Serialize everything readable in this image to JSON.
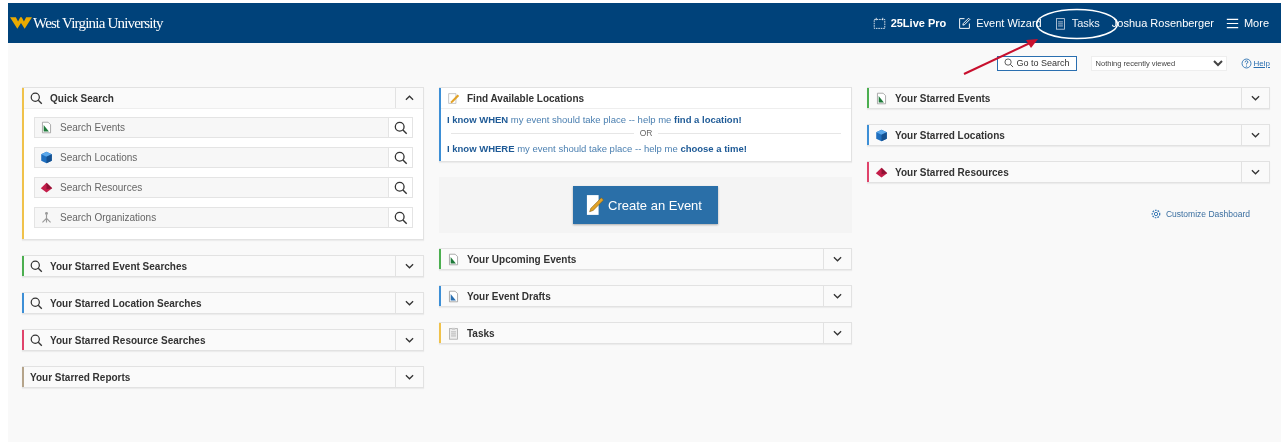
{
  "header": {
    "logo": "West Virginia University",
    "nav": [
      {
        "kind": "calendar",
        "label": "25Live Pro",
        "circled": false
      },
      {
        "kind": "edit",
        "label": "Event Wizard",
        "circled": false
      },
      {
        "kind": "clipboard",
        "label": "Tasks",
        "circled": true
      },
      {
        "kind": "user",
        "label": "Joshua Rosenberger",
        "circled": false
      },
      {
        "kind": "menu",
        "label": "More",
        "circled": false
      }
    ]
  },
  "toolbar": {
    "search_button": "Go to Search",
    "recent": {
      "value": "Nothing recently viewed"
    },
    "help": "Help"
  },
  "columns": [
    [
      {
        "kind": "quick_search",
        "title": "Quick Search",
        "color": "#f0c24b",
        "expanded": true,
        "items": [
          {
            "kind": "event",
            "placeholder": "Search Events"
          },
          {
            "kind": "location",
            "placeholder": "Search Locations"
          },
          {
            "kind": "resource",
            "placeholder": "Search Resources"
          },
          {
            "kind": "organization",
            "placeholder": "Search Organizations"
          }
        ]
      },
      {
        "kind": "searches",
        "title": "Your Starred Event Searches",
        "color": "#4caf50",
        "expanded": false
      },
      {
        "kind": "searches",
        "title": "Your Starred Location Searches",
        "color": "#3d8fd6",
        "expanded": false
      },
      {
        "kind": "searches",
        "title": "Your Starred Resource Searches",
        "color": "#e0436b",
        "expanded": false
      },
      {
        "kind": "reports",
        "title": "Your Starred Reports",
        "color": "#b5a48a",
        "expanded": false
      }
    ],
    [
      {
        "kind": "find_locations",
        "title": "Find Available Locations",
        "color": "#3d8fd6",
        "options": [
          "**I know WHEN** my event should take place -- help me **find a location!**",
          "**I know WHERE** my event should take place -- help me **choose a time!**"
        ],
        "separator": "OR"
      },
      {
        "kind": "create_button",
        "label": "Create an Event"
      },
      {
        "kind": "events",
        "title": "Your Upcoming Events",
        "color": "#4caf50",
        "expanded": false
      },
      {
        "kind": "drafts",
        "title": "Your Event Drafts",
        "color": "#3d8fd6",
        "expanded": false
      },
      {
        "kind": "tasks",
        "title": "Tasks",
        "color": "#f0c24b",
        "expanded": false
      }
    ],
    [
      {
        "kind": "events",
        "title": "Your Starred Events",
        "color": "#4caf50",
        "expanded": false
      },
      {
        "kind": "locations",
        "title": "Your Starred Locations",
        "color": "#3d8fd6",
        "expanded": false
      },
      {
        "kind": "resources",
        "title": "Your Starred Resources",
        "color": "#e0436b",
        "expanded": false
      },
      {
        "kind": "customize_link",
        "label": "Customize Dashboard"
      }
    ]
  ]
}
